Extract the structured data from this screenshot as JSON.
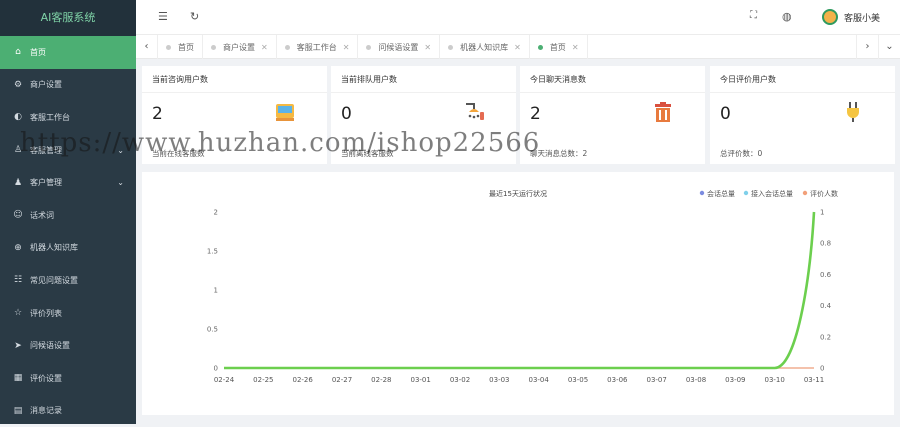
{
  "app": {
    "title": "AI客服系统"
  },
  "sidebar": {
    "items": [
      {
        "label": "首页",
        "icon": "home-icon",
        "active": true
      },
      {
        "label": "商户设置",
        "icon": "gear-icon"
      },
      {
        "label": "客服工作台",
        "icon": "headset-icon"
      },
      {
        "label": "客服管理",
        "icon": "user-icon",
        "expandable": true
      },
      {
        "label": "客户管理",
        "icon": "users-icon",
        "expandable": true
      },
      {
        "label": "话术词",
        "icon": "smile-icon"
      },
      {
        "label": "机器人知识库",
        "icon": "robot-icon"
      },
      {
        "label": "常见问题设置",
        "icon": "faq-icon"
      },
      {
        "label": "评价列表",
        "icon": "star-icon"
      },
      {
        "label": "问候语设置",
        "icon": "send-icon"
      },
      {
        "label": "评价设置",
        "icon": "calendar-icon"
      },
      {
        "label": "消息记录",
        "icon": "message-icon"
      }
    ]
  },
  "topbar": {
    "user_name": "客服小美"
  },
  "tabs": [
    {
      "label": "首页",
      "closable": false,
      "active": false
    },
    {
      "label": "商户设置",
      "closable": true,
      "active": false
    },
    {
      "label": "客服工作台",
      "closable": true,
      "active": false
    },
    {
      "label": "问候语设置",
      "closable": true,
      "active": false
    },
    {
      "label": "机器人知识库",
      "closable": true,
      "active": false
    },
    {
      "label": "首页",
      "closable": true,
      "active": true
    }
  ],
  "cards": [
    {
      "title": "当前咨询用户数",
      "value": "2",
      "sub": "当前在线客服数",
      "icon": "cup-icon"
    },
    {
      "title": "当前排队用户数",
      "value": "0",
      "sub": "当前离线客服数",
      "icon": "shower-icon"
    },
    {
      "title": "今日聊天消息数",
      "value": "2",
      "sub": "聊天消息总数：2",
      "icon": "trash-icon"
    },
    {
      "title": "今日评价用户数",
      "value": "0",
      "sub": "总评价数：0",
      "icon": "plug-icon"
    }
  ],
  "watermark": "https://www.huzhan.com/ishop22566",
  "chart_data": {
    "type": "line",
    "title": "最近15天运行状况",
    "x": [
      "02-24",
      "02-25",
      "02-26",
      "02-27",
      "02-28",
      "03-01",
      "03-02",
      "03-03",
      "03-04",
      "03-05",
      "03-06",
      "03-07",
      "03-08",
      "03-09",
      "03-10",
      "03-11"
    ],
    "y_left_ticks": [
      "0",
      "0.5",
      "1",
      "1.5",
      "2"
    ],
    "y_right_ticks": [
      "0",
      "0.2",
      "0.4",
      "0.6",
      "0.8",
      "1"
    ],
    "ylim_left": [
      0,
      2
    ],
    "ylim_right": [
      0,
      1
    ],
    "legend_position": "top-right",
    "series": [
      {
        "name": "会话总量",
        "color": "#7c8ce0",
        "axis": "left",
        "values": [
          0,
          0,
          0,
          0,
          0,
          0,
          0,
          0,
          0,
          0,
          0,
          0,
          0,
          0,
          0,
          2
        ]
      },
      {
        "name": "接入会话总量",
        "color": "#7fd0ea",
        "axis": "left",
        "values": [
          0,
          0,
          0,
          0,
          0,
          0,
          0,
          0,
          0,
          0,
          0,
          0,
          0,
          0,
          0,
          2
        ]
      },
      {
        "name": "评价人数",
        "color": "#f2a07a",
        "axis": "left",
        "values": [
          0,
          0,
          0,
          0,
          0,
          0,
          0,
          0,
          0,
          0,
          0,
          0,
          0,
          0,
          0,
          0
        ]
      },
      {
        "name": "",
        "color": "#6ccf4e",
        "axis": "right",
        "values": [
          0,
          0,
          0,
          0,
          0,
          0,
          0,
          0,
          0,
          0,
          0,
          0,
          0,
          0,
          0,
          1
        ]
      }
    ]
  }
}
